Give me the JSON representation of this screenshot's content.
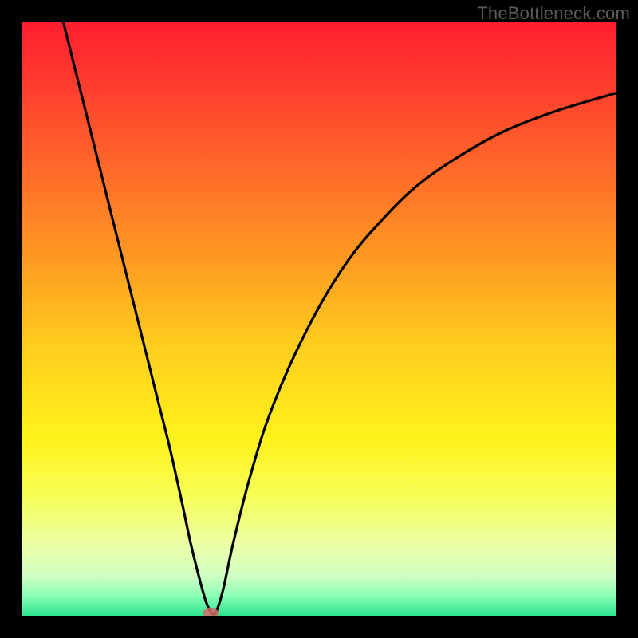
{
  "watermark": "TheBottleneck.com",
  "chart_data": {
    "type": "line",
    "title": "",
    "xlabel": "",
    "ylabel": "",
    "xlim": [
      0,
      100
    ],
    "ylim": [
      0,
      100
    ],
    "gradient_stops": [
      {
        "offset": 0.0,
        "color": "#ff1e2f"
      },
      {
        "offset": 0.1,
        "color": "#ff3a2e"
      },
      {
        "offset": 0.25,
        "color": "#ff6a2a"
      },
      {
        "offset": 0.4,
        "color": "#ff9a22"
      },
      {
        "offset": 0.55,
        "color": "#ffcf1e"
      },
      {
        "offset": 0.7,
        "color": "#fff21a"
      },
      {
        "offset": 0.8,
        "color": "#f6ff58"
      },
      {
        "offset": 0.88,
        "color": "#ecffa8"
      },
      {
        "offset": 0.93,
        "color": "#d2ffc2"
      },
      {
        "offset": 0.965,
        "color": "#8cffb8"
      },
      {
        "offset": 1.0,
        "color": "#28e58f"
      }
    ],
    "series": [
      {
        "name": "bottleneck-curve",
        "x": [
          7,
          9,
          11,
          13,
          15,
          17,
          19,
          21,
          23,
          25,
          27,
          28.5,
          30,
          31,
          31.8,
          32.4,
          33.0,
          34.0,
          35.5,
          38,
          41,
          45,
          50,
          55,
          60,
          66,
          73,
          81,
          90,
          100
        ],
        "y": [
          100,
          92,
          84,
          76,
          68,
          60,
          52,
          44,
          36,
          28,
          19,
          12,
          6,
          2.5,
          0.8,
          0.4,
          1.5,
          5,
          12,
          22,
          32,
          42,
          52,
          60,
          66,
          72,
          77,
          81.5,
          85,
          88
        ]
      }
    ],
    "marker": {
      "x": 31.8,
      "y": 0.6,
      "color": "#d46a6a"
    }
  }
}
